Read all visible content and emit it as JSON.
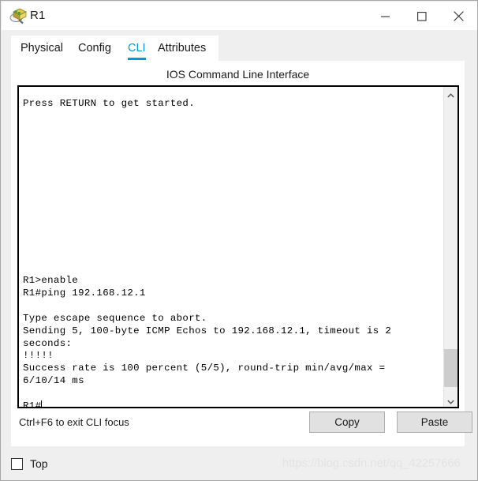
{
  "window": {
    "title": "R1",
    "icon": "router-magnifier-icon",
    "controls": {
      "minimize": "minimize-icon",
      "maximize": "maximize-icon",
      "close": "close-icon"
    }
  },
  "tabs": [
    {
      "label": "Physical",
      "active": false
    },
    {
      "label": "Config",
      "active": false
    },
    {
      "label": "CLI",
      "active": true
    },
    {
      "label": "Attributes",
      "active": false
    }
  ],
  "panel": {
    "heading": "IOS Command Line Interface",
    "terminal": {
      "content": "Press RETURN to get started.\n\n\n\n\n\n\n\n\n\n\n\n\n\nR1>enable\nR1#ping 192.168.12.1\n\nType escape sequence to abort.\nSending 5, 100-byte ICMP Echos to 192.168.12.1, timeout is 2\nseconds:\n!!!!!\nSuccess rate is 100 percent (5/5), round-trip min/avg/max =\n6/10/14 ms\n\nR1#",
      "scrollbar": {
        "up_icon": "chevron-up-icon",
        "down_icon": "chevron-down-icon"
      }
    },
    "hint": "Ctrl+F6 to exit CLI focus",
    "buttons": {
      "copy": "Copy",
      "paste": "Paste"
    }
  },
  "bottom": {
    "top_checkbox_label": "Top",
    "top_checkbox_checked": false
  },
  "watermark": "https://blog.csdn.net/qq_42257666",
  "colors": {
    "accent": "#0099dd",
    "window_bg": "#efefef",
    "panel_bg": "#ffffff",
    "button_bg": "#e1e1e1",
    "scroll_thumb": "#cdcdcd"
  }
}
